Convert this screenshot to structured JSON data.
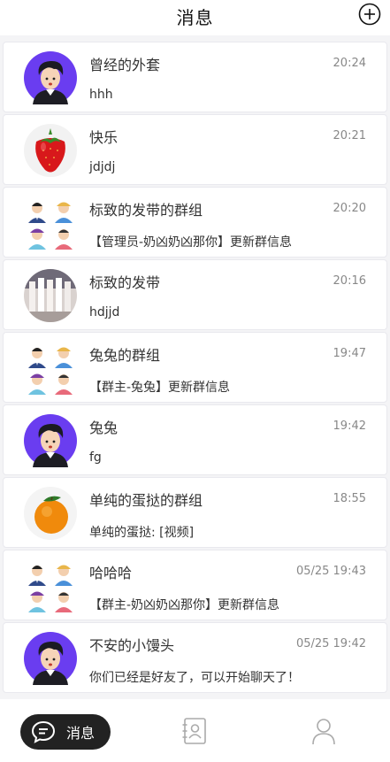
{
  "header": {
    "title": "消息"
  },
  "conversations": [
    {
      "name": "曾经的外套",
      "time": "20:24",
      "preview": "hhh",
      "avatar": "boy-avatar"
    },
    {
      "name": "快乐",
      "time": "20:21",
      "preview": "jdjdj",
      "avatar": "strawberry-avatar"
    },
    {
      "name": "标致的发带的群组",
      "time": "20:20",
      "preview": "【管理员-奶凶奶凶那你】更新群信息",
      "avatar": "group-avatar"
    },
    {
      "name": "标致的发带",
      "time": "20:16",
      "preview": "hdjjd",
      "avatar": "photo-avatar"
    },
    {
      "name": "兔兔的群组",
      "time": "19:47",
      "preview": "【群主-兔兔】更新群信息",
      "avatar": "group-avatar"
    },
    {
      "name": "兔兔",
      "time": "19:42",
      "preview": "fg",
      "avatar": "boy-avatar"
    },
    {
      "name": "单纯的蛋挞的群组",
      "time": "18:55",
      "preview": "单纯的蛋挞: [视频]",
      "avatar": "orange-avatar"
    },
    {
      "name": "哈哈哈",
      "time": "05/25 19:43",
      "preview": "【群主-奶凶奶凶那你】更新群信息",
      "avatar": "group-avatar"
    },
    {
      "name": "不安的小馒头",
      "time": "05/25 19:42",
      "preview": "你们已经是好友了，可以开始聊天了！",
      "avatar": "boy-avatar"
    }
  ],
  "tabbar": {
    "messages_label": "消息"
  },
  "colors": {
    "accent": "#222222",
    "avatar_bg": "#6a3df0",
    "time": "#888888"
  }
}
